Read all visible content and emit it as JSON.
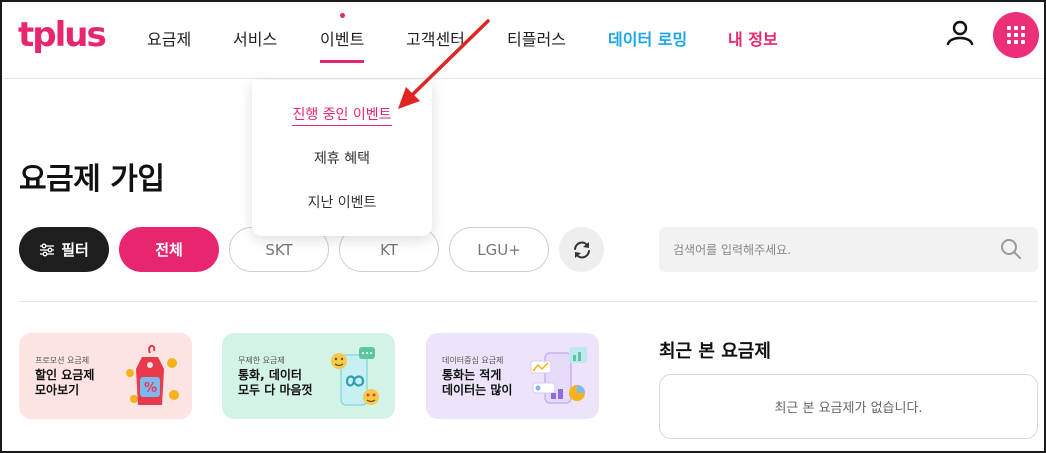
{
  "header": {
    "logo": "tplus",
    "nav": [
      "요금제",
      "서비스",
      "이벤트",
      "고객센터",
      "티플러스",
      "데이터 로밍",
      "내 정보"
    ],
    "active_nav": "이벤트",
    "accent": "#e8256f",
    "roaming_color": "#19a6e6"
  },
  "dropdown": {
    "items": [
      "진행 중인 이벤트",
      "제휴 혜택",
      "지난 이벤트"
    ],
    "active_item": "진행 중인 이벤트"
  },
  "main": {
    "title": "요금제 가입",
    "filter_label": "필터",
    "chips": [
      "전체",
      "SKT",
      "KT",
      "LGU+"
    ],
    "selected_chip": "전체",
    "search_placeholder": "검색어를 입력해주세요.",
    "cards": [
      {
        "eyebrow": "프로모션 요금제",
        "title": "할인 요금제\n모아보기",
        "bg": "#fde3e2"
      },
      {
        "eyebrow": "무제한 요금제",
        "title": "통화, 데이터\n모두 다 마음껏",
        "bg": "#d3f3e6"
      },
      {
        "eyebrow": "데이터중심 요금제",
        "title": "통화는 적게\n데이터는 많이",
        "bg": "#ede3fa"
      }
    ],
    "recent": {
      "title": "최근 본 요금제",
      "empty": "최근 본 요금제가 없습니다."
    }
  },
  "icons": {
    "user": "user-icon",
    "menu": "grid-menu-icon",
    "filter": "sliders-icon",
    "refresh": "refresh-icon",
    "search": "search-icon",
    "annotation": "red-arrow-annotation"
  }
}
